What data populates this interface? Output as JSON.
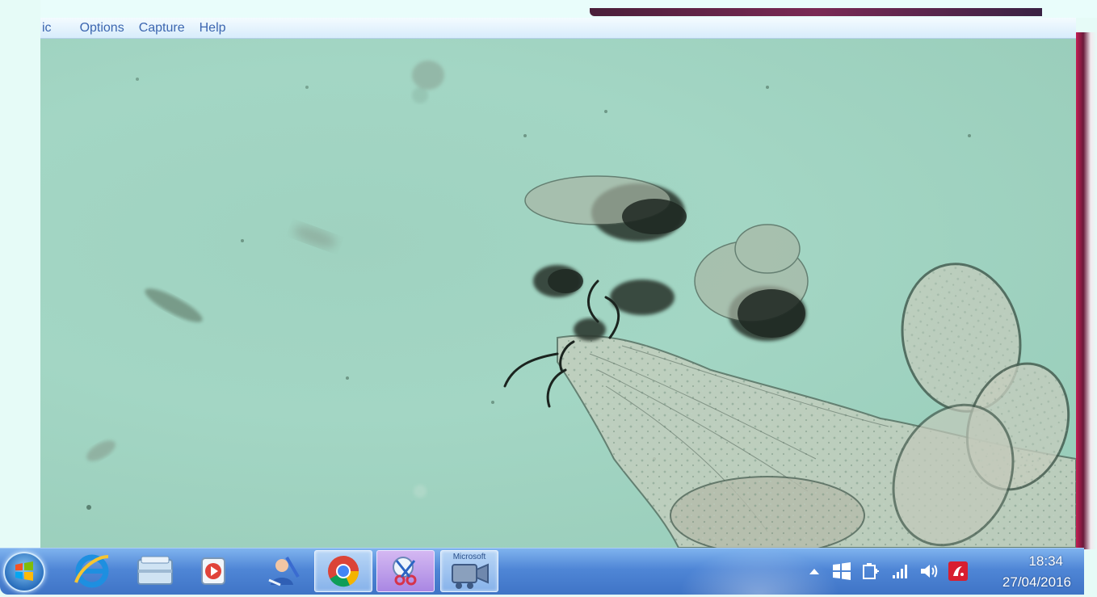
{
  "menu": {
    "items": [
      {
        "label": "ic"
      },
      {
        "label": "Options"
      },
      {
        "label": "Capture"
      },
      {
        "label": "Help"
      }
    ]
  },
  "preview": {
    "content": "microscope-sample-image"
  },
  "taskbar": {
    "pinned": [
      {
        "icon": "start-orb-icon"
      },
      {
        "icon": "internet-explorer-icon"
      },
      {
        "icon": "file-explorer-icon"
      },
      {
        "icon": "media-player-icon"
      },
      {
        "icon": "paint-app-icon"
      },
      {
        "icon": "chrome-icon"
      },
      {
        "icon": "snipping-tool-icon"
      },
      {
        "icon": "video-capture-app-icon",
        "label": "Microsoft"
      }
    ],
    "tray": {
      "icons": [
        "show-hidden-icons-arrow",
        "windows-flag-icon",
        "power-plug-icon",
        "network-signal-icon",
        "volume-icon",
        "antivirus-icon"
      ],
      "time": "18:34",
      "date": "27/04/2016"
    }
  },
  "colors": {
    "menu_text": "#3c66b0",
    "preview_bg": "#a3d6c4",
    "taskbar": "#4f86d6"
  }
}
